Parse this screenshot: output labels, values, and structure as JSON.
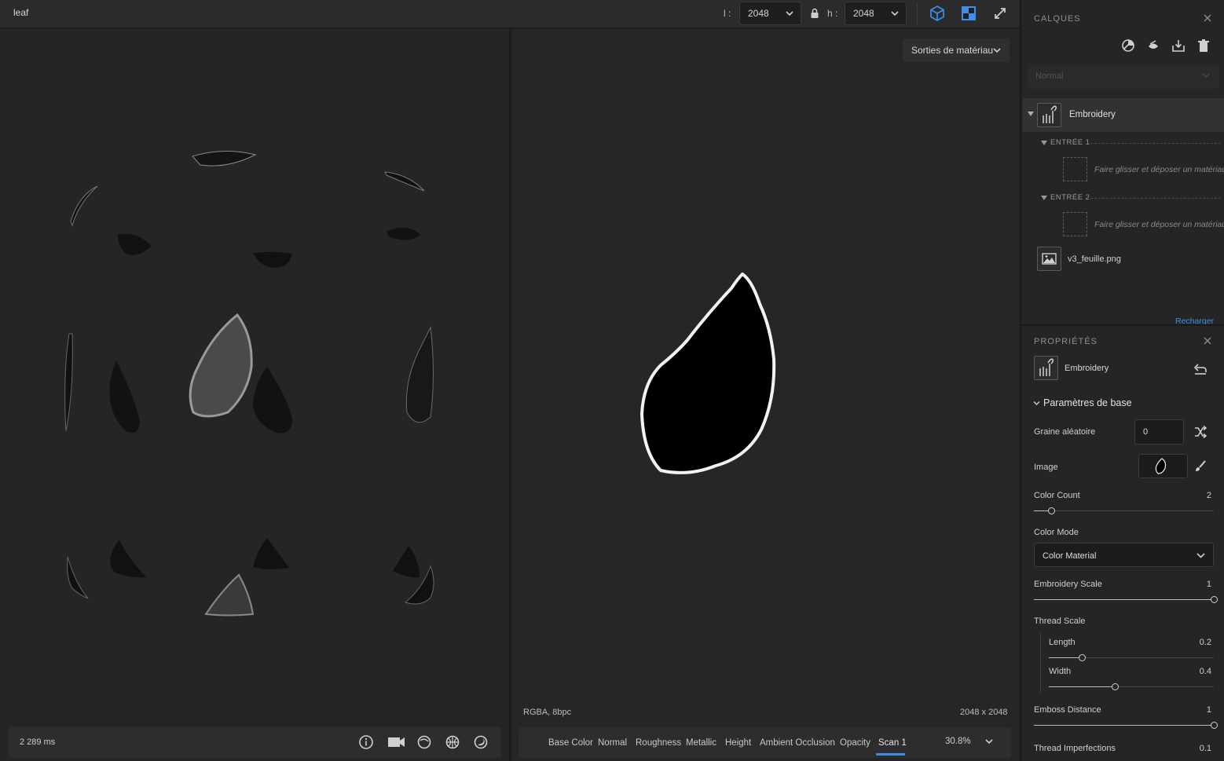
{
  "document": {
    "title": "leaf"
  },
  "size": {
    "width_label": "l :",
    "width_value": "2048",
    "height_label": "h :",
    "height_value": "2048"
  },
  "outputs_dropdown": {
    "label": "Sorties de matériau"
  },
  "left_viewport": {
    "timing": "2 289 ms"
  },
  "right_viewport": {
    "format": "RGBA, 8bpc",
    "resolution": "2048 x 2048",
    "channels": [
      "Base Color",
      "Normal",
      "Roughness",
      "Metallic",
      "Height",
      "Ambient Occlusion",
      "Opacity",
      "Scan 1"
    ],
    "active_channel": "Scan 1",
    "zoom": "30.8%"
  },
  "layers_panel": {
    "title": "CALQUES",
    "blend_mode": "Normal",
    "layer": {
      "name": "Embroidery"
    },
    "inputs": [
      {
        "label": "ENTRÉE 1",
        "placeholder": "Faire glisser et déposer un matériau"
      },
      {
        "label": "ENTRÉE 2",
        "placeholder": "Faire glisser et déposer un matériau"
      }
    ],
    "image_layer": {
      "name": "v3_feuille.png"
    },
    "reload": "Recharger"
  },
  "properties_panel": {
    "title": "PROPRIÉTÉS",
    "filter_name": "Embroidery",
    "section": "Paramètres de base",
    "random_seed": {
      "label": "Graine aléatoire",
      "value": "0"
    },
    "image": {
      "label": "Image"
    },
    "color_count": {
      "label": "Color Count",
      "value": "2",
      "fraction": 0.1
    },
    "color_mode": {
      "label": "Color Mode",
      "value": "Color Material"
    },
    "embroidery_scale": {
      "label": "Embroidery Scale",
      "value": "1",
      "fraction": 1.0
    },
    "thread_scale": {
      "label": "Thread Scale",
      "length": {
        "label": "Length",
        "value": "0.2",
        "fraction": 0.2
      },
      "width": {
        "label": "Width",
        "value": "0.4",
        "fraction": 0.4
      }
    },
    "emboss_distance": {
      "label": "Emboss Distance",
      "value": "1",
      "fraction": 1.0
    },
    "thread_imperfections": {
      "label": "Thread Imperfections",
      "value": "0.1"
    }
  },
  "colors": {
    "accent": "#3d8eea",
    "panel_bg": "#252525",
    "viewport_bg": "#262626"
  }
}
